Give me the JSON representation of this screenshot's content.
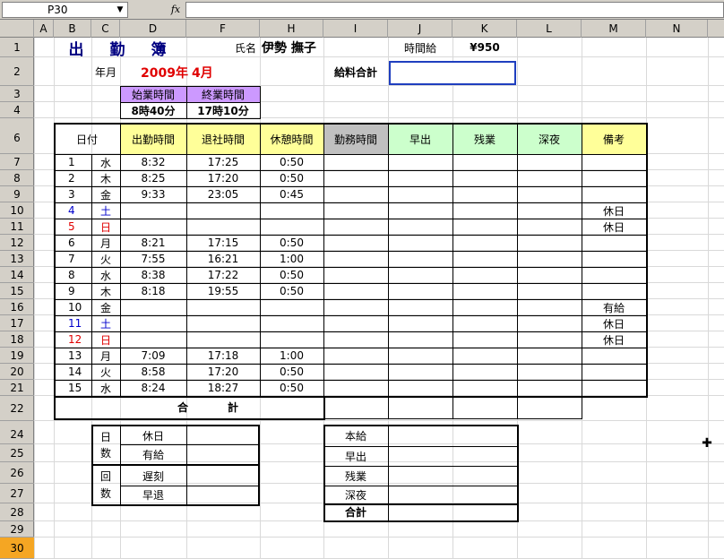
{
  "formula_bar": {
    "name_box": "P30",
    "fx": "fx"
  },
  "columns": [
    "A",
    "B",
    "C",
    "D",
    "F",
    "H",
    "I",
    "J",
    "K",
    "L",
    "M",
    "N"
  ],
  "rows": [
    "1",
    "2",
    "3",
    "4",
    "6",
    "7",
    "8",
    "9",
    "10",
    "11",
    "12",
    "13",
    "14",
    "15",
    "16",
    "17",
    "18",
    "19",
    "20",
    "21",
    "22",
    "24",
    "25",
    "26",
    "27",
    "28",
    "29",
    "30"
  ],
  "sheet": {
    "title": "出　勤　簿",
    "name_label": "氏名",
    "name_value": "伊勢 撫子",
    "hourly_label": "時間給",
    "hourly_value": "¥950",
    "yearmonth_label": "年月",
    "year": "2009年",
    "month": "4月",
    "salary_label": "給料合計",
    "start_label": "始業時間",
    "end_label": "終業時間",
    "start_value": "8時40分",
    "end_value": "17時10分",
    "headers": {
      "date": "日付",
      "in": "出勤時間",
      "out": "退社時間",
      "break": "休憩時間",
      "work": "勤務時間",
      "early": "早出",
      "overtime": "残業",
      "night": "深夜",
      "note": "備考"
    },
    "days": [
      {
        "d": "1",
        "w": "水",
        "in": "8:32",
        "out": "17:25",
        "br": "0:50",
        "note": "",
        "color": ""
      },
      {
        "d": "2",
        "w": "木",
        "in": "8:25",
        "out": "17:20",
        "br": "0:50",
        "note": "",
        "color": ""
      },
      {
        "d": "3",
        "w": "金",
        "in": "9:33",
        "out": "23:05",
        "br": "0:45",
        "note": "",
        "color": ""
      },
      {
        "d": "4",
        "w": "土",
        "in": "",
        "out": "",
        "br": "",
        "note": "休日",
        "color": "blue"
      },
      {
        "d": "5",
        "w": "日",
        "in": "",
        "out": "",
        "br": "",
        "note": "休日",
        "color": "red"
      },
      {
        "d": "6",
        "w": "月",
        "in": "8:21",
        "out": "17:15",
        "br": "0:50",
        "note": "",
        "color": ""
      },
      {
        "d": "7",
        "w": "火",
        "in": "7:55",
        "out": "16:21",
        "br": "1:00",
        "note": "",
        "color": ""
      },
      {
        "d": "8",
        "w": "水",
        "in": "8:38",
        "out": "17:22",
        "br": "0:50",
        "note": "",
        "color": ""
      },
      {
        "d": "9",
        "w": "木",
        "in": "8:18",
        "out": "19:55",
        "br": "0:50",
        "note": "",
        "color": ""
      },
      {
        "d": "10",
        "w": "金",
        "in": "",
        "out": "",
        "br": "",
        "note": "有給",
        "color": ""
      },
      {
        "d": "11",
        "w": "土",
        "in": "",
        "out": "",
        "br": "",
        "note": "休日",
        "color": "blue"
      },
      {
        "d": "12",
        "w": "日",
        "in": "",
        "out": "",
        "br": "",
        "note": "休日",
        "color": "red"
      },
      {
        "d": "13",
        "w": "月",
        "in": "7:09",
        "out": "17:18",
        "br": "1:00",
        "note": "",
        "color": ""
      },
      {
        "d": "14",
        "w": "火",
        "in": "8:58",
        "out": "17:20",
        "br": "0:50",
        "note": "",
        "color": ""
      },
      {
        "d": "15",
        "w": "水",
        "in": "8:24",
        "out": "18:27",
        "br": "0:50",
        "note": "",
        "color": ""
      }
    ],
    "total_a": "合",
    "total_b": "計",
    "days_label_a": "日",
    "days_label_b": "数",
    "holiday": "休日",
    "paid": "有給",
    "times_label_a": "回",
    "times_label_b": "数",
    "late": "遅刻",
    "leave_early": "早退",
    "base_pay": "本給",
    "early_pay": "早出",
    "overtime_pay": "残業",
    "night_pay": "深夜",
    "pay_total": "合計"
  },
  "colors": {
    "purple": "#cc99ff",
    "yellow": "#ffff99",
    "green": "#ccffcc",
    "gray": "#c0c0c0",
    "title_blue": "#000080",
    "selected_row": "#f5a623"
  }
}
